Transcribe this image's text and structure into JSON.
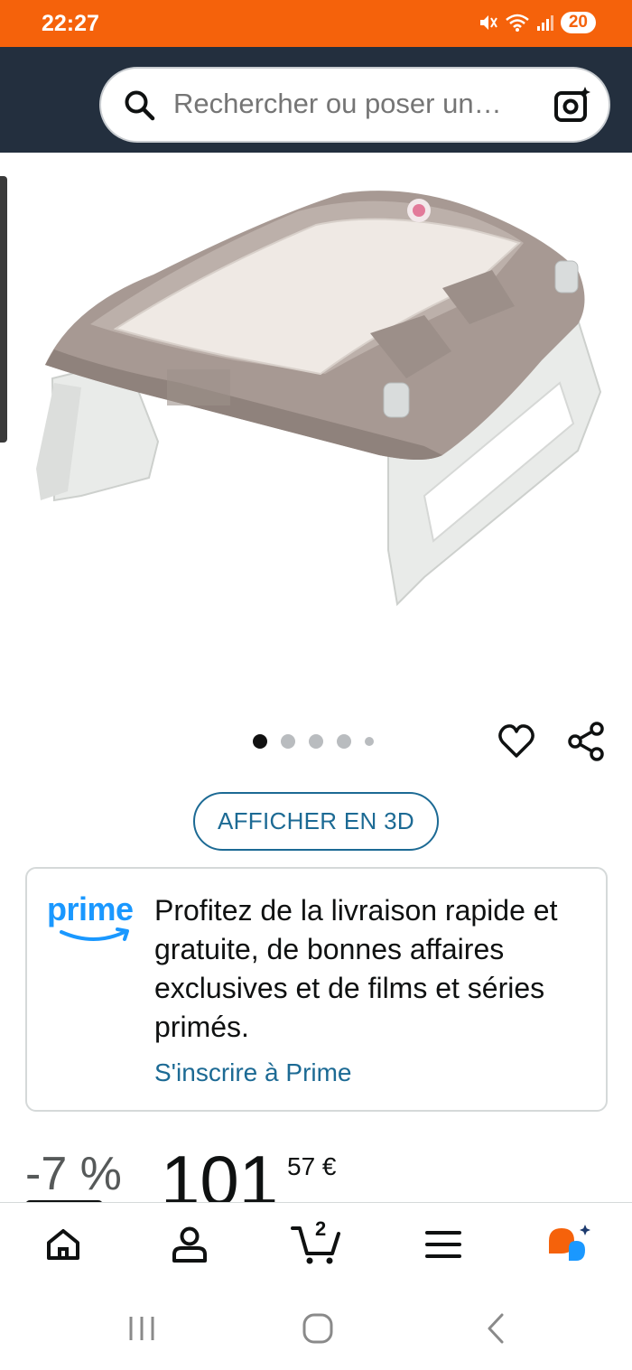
{
  "status_bar": {
    "time": "22:27",
    "battery": "20",
    "icons": [
      "mute-icon",
      "wifi-icon",
      "signal-icon"
    ]
  },
  "search": {
    "placeholder": "Rechercher ou poser un…"
  },
  "product": {
    "image_alt": "product-image-changing-table",
    "image_count": 5,
    "active_image_index": 0
  },
  "actions": {
    "view_3d_label": "AFFICHER EN 3D"
  },
  "prime_card": {
    "logo_text": "prime",
    "description": "Profitez de la livraison rapide et gratuite, de bonnes affaires exclusives et de films et séries primés.",
    "link_label": "S'inscrire à Prime"
  },
  "price": {
    "discount": "-7 %",
    "whole": "101",
    "fraction": "57 €"
  },
  "bottom_nav": {
    "cart_count": "2",
    "items": [
      "home-icon",
      "account-icon",
      "cart-icon",
      "menu-icon",
      "rufus-icon"
    ]
  },
  "colors": {
    "status_bar": "#f5620b",
    "header": "#232f3e",
    "link": "#1c6a94",
    "prime_blue": "#1a98ff"
  }
}
